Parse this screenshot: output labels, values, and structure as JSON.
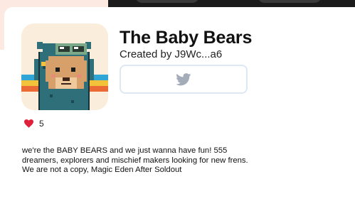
{
  "collection": {
    "name": "The Baby Bears",
    "creator_text": "Created by J9Wc...a6",
    "likes_count": "5",
    "description": "we're the BABY BEARS and we just wanna have fun! 555 dreamers, explorers and mischief makers looking for new frens. We are not a copy, Magic Eden After Soldout"
  },
  "icons": {
    "twitter": "twitter-bird-icon",
    "like": "heart-icon"
  },
  "colors": {
    "heart": "#e0203a",
    "twitter_icon": "#a3acb8",
    "button_border": "#dde8f4"
  }
}
